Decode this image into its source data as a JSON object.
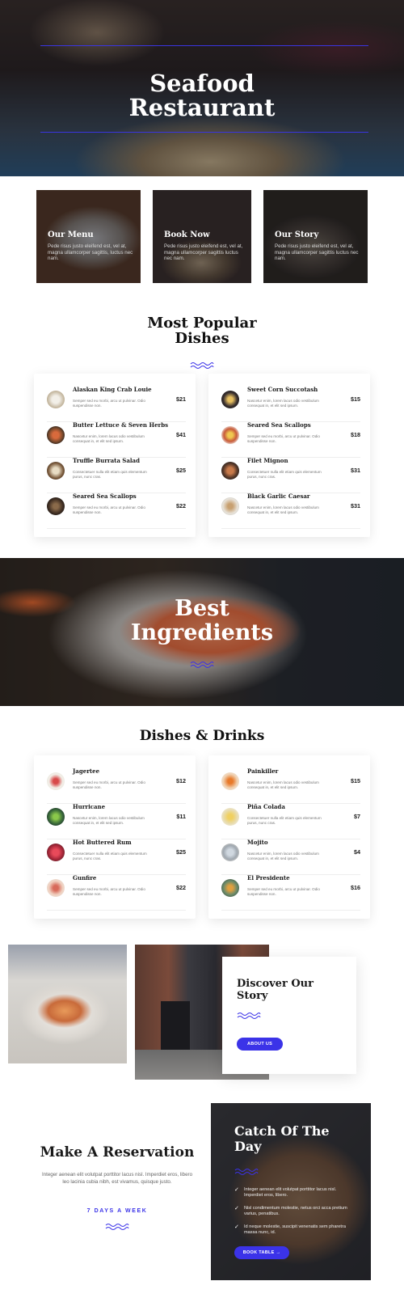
{
  "hero": {
    "title_line1": "Seafood",
    "title_line2": "Restaurant"
  },
  "cards": [
    {
      "title": "Our Menu",
      "text": "Pede risus justo eleifend est, vel at, magna ullamcorper sagittis, luctus nec nam."
    },
    {
      "title": "Book Now",
      "text": "Pede risus justo eleifend est, vel at, magna ullamcorper sagittis luctus nec nam."
    },
    {
      "title": "Our Story",
      "text": "Pede risus justo eleifend est, vel at, magna ullamcorper sagittis luctus nec nam."
    }
  ],
  "popular": {
    "title_line1": "Most Popular",
    "title_line2": "Dishes",
    "left": [
      {
        "name": "Alaskan King Crab Louie",
        "desc": "Semper sed eu morbi, arcu ut pulvinar. Odio suspendisse non.",
        "price": "$21"
      },
      {
        "name": "Butter Lettuce & Seven Herbs",
        "desc": "Nascetur enim, lorem lacus odio vestibulum consequat in, et elit sed ipsum.",
        "price": "$41"
      },
      {
        "name": "Truffle Burrata Salad",
        "desc": "Consectetuer nulla elit etiam quis elementum purus, nunc cras.",
        "price": "$25"
      },
      {
        "name": "Seared Sea Scallops",
        "desc": "Semper sed eu morbi, arcu ut pulvinar. Odio suspendisse non.",
        "price": "$22"
      }
    ],
    "right": [
      {
        "name": "Sweet Corn Succotash",
        "desc": "Nascetur enim, lorem lacus odio vestibulum consequat in, et elit sed ipsum.",
        "price": "$15"
      },
      {
        "name": "Seared Sea Scallops",
        "desc": "Semper sed eu morbi, arcu ut pulvinar. Odio suspendisse non.",
        "price": "$18"
      },
      {
        "name": "Filet Mignon",
        "desc": "Consectetuer nulla elit etiam quis elementum purus, nunc cras.",
        "price": "$31"
      },
      {
        "name": "Black Garlic Caesar",
        "desc": "Nascetur enim, lorem lacus odio vestibulum consequat in, et elit sed ipsum.",
        "price": "$31"
      }
    ]
  },
  "band": {
    "title_line1": "Best",
    "title_line2": "Ingredients"
  },
  "drinks": {
    "title": "Dishes & Drinks",
    "left": [
      {
        "name": "Jagertee",
        "desc": "Semper sed eu morbi, arcu ut pulvinar. Odio suspendisse non.",
        "price": "$12"
      },
      {
        "name": "Hurricane",
        "desc": "Nascetur enim, lorem lacus odio vestibulum consequat in, et elit sed ipsum.",
        "price": "$11"
      },
      {
        "name": "Hot Buttered Rum",
        "desc": "Consectetuer nulla elit etiam quis elementum purus, nunc cras.",
        "price": "$25"
      },
      {
        "name": "Gunfire",
        "desc": "Semper sed eu morbi, arcu ut pulvinar. Odio suspendisse non.",
        "price": "$22"
      }
    ],
    "right": [
      {
        "name": "Painkiller",
        "desc": "Nascetur enim, lorem lacus odio vestibulum consequat in, et elit sed ipsum.",
        "price": "$15"
      },
      {
        "name": "Piña Colada",
        "desc": "Consectetuer nulla elit etiam quis elementum purus, nunc cras.",
        "price": "$7"
      },
      {
        "name": "Mojito",
        "desc": "Nascetur enim, lorem lacus odio vestibulum consequat in, et elit sed ipsum.",
        "price": "$4"
      },
      {
        "name": "El Presidente",
        "desc": "Semper sed eu morbi, arcu ut pulvinar. Odio suspendisse non.",
        "price": "$16"
      }
    ]
  },
  "story": {
    "title_line1": "Discover Our",
    "title_line2": "Story",
    "button": "ABOUT US"
  },
  "reservation": {
    "title": "Make A Reservation",
    "text": "Integer aenean elit volutpat porttitor lacus nisl. Imperdiet eros, libero leo lacinia cubia nibh, est vivamus, quisque justo.",
    "days": "7 DAYS A WEEK"
  },
  "catch": {
    "title_line1": "Catch Of The",
    "title_line2": "Day",
    "items": [
      "Integer aenean elit volutpat porttitor lacus nisl. Imperdiet eros, libero.",
      "Nisl condimentum molestie, netus orci acca pretium varius, penatibus.",
      "Id neque molestie, suscipit venenatis sem pharetra massa nunc, id."
    ],
    "button": "BOOK TABLE →"
  },
  "colors": {
    "accent": "#3b33e8"
  }
}
